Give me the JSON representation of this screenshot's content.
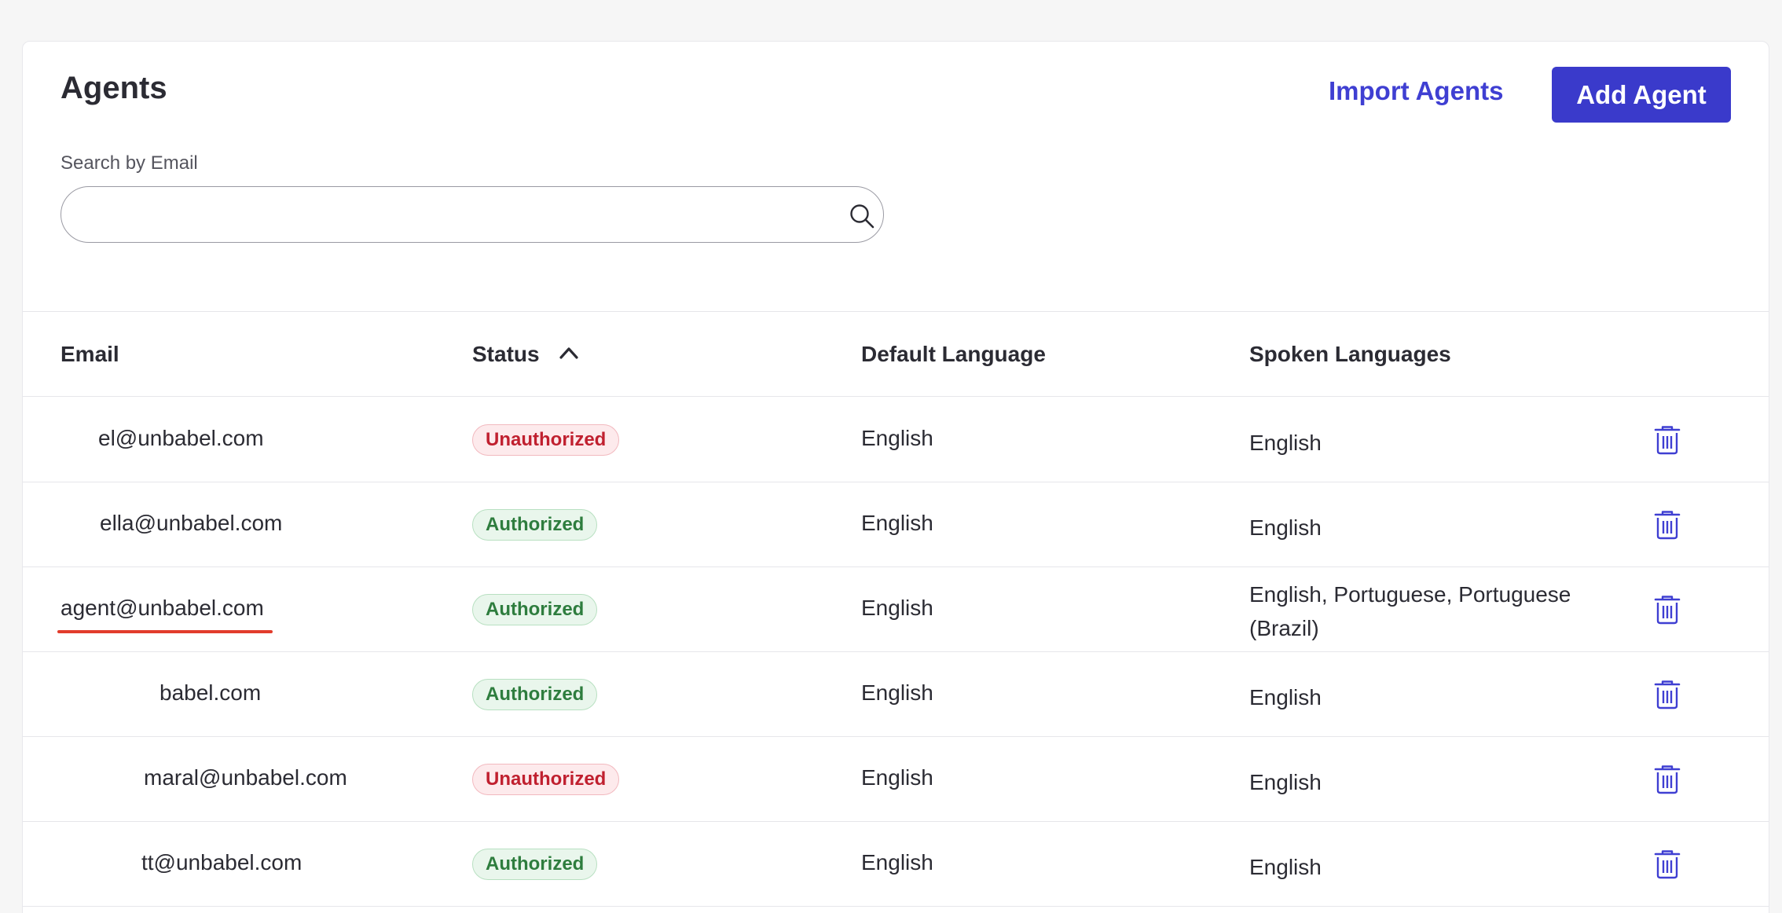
{
  "header": {
    "title": "Agents",
    "import_label": "Import Agents",
    "add_label": "Add Agent"
  },
  "search": {
    "label": "Search by Email",
    "value": "",
    "placeholder": ""
  },
  "table": {
    "columns": {
      "email": "Email",
      "status": "Status",
      "default_language": "Default Language",
      "spoken_languages": "Spoken Languages"
    },
    "sort": {
      "column": "Status",
      "direction": "ascending",
      "icon": "chevron-up-icon"
    },
    "rows": [
      {
        "email": "el@unbabel.com",
        "status": "Unauthorized",
        "default_language": "English",
        "spoken_languages": "English"
      },
      {
        "email": "ella@unbabel.com",
        "status": "Authorized",
        "default_language": "English",
        "spoken_languages": "English"
      },
      {
        "email": "agent@unbabel.com",
        "status": "Authorized",
        "default_language": "English",
        "spoken_languages": "English, Portuguese, Portuguese (Brazil)"
      },
      {
        "email": "babel.com",
        "status": "Authorized",
        "default_language": "English",
        "spoken_languages": "English"
      },
      {
        "email": "maral@unbabel.com",
        "status": "Unauthorized",
        "default_language": "English",
        "spoken_languages": "English"
      },
      {
        "email": "tt@unbabel.com",
        "status": "Authorized",
        "default_language": "English",
        "spoken_languages": "English"
      }
    ]
  },
  "colors": {
    "accent": "#3a3acb",
    "link": "#3f3fd2",
    "authorized": "#2e7d3e",
    "unauthorized": "#c0202f",
    "highlight_underline": "#e23c2c"
  }
}
